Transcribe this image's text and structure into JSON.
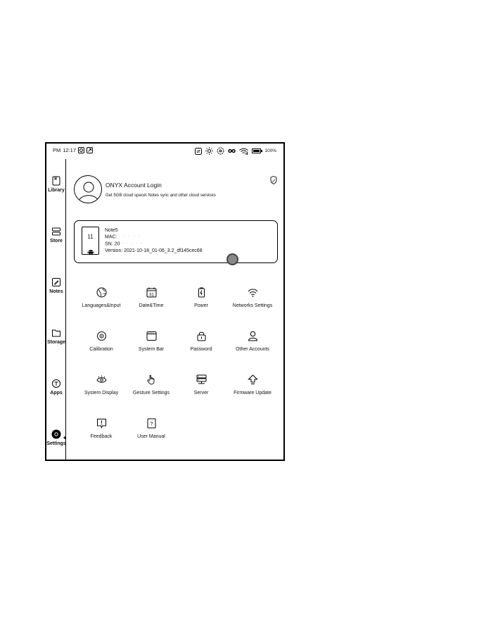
{
  "status_bar": {
    "time_period": "PM",
    "time": "12:17",
    "battery": "100%"
  },
  "sidebar": {
    "items": [
      {
        "label": "Library",
        "icon": "book-icon"
      },
      {
        "label": "Store",
        "icon": "store-icon"
      },
      {
        "label": "Notes",
        "icon": "pen-icon"
      },
      {
        "label": "Storage",
        "icon": "folder-icon"
      },
      {
        "label": "Apps",
        "icon": "apps-icon"
      },
      {
        "label": "Settings",
        "icon": "settings-icon",
        "active": true
      }
    ]
  },
  "account": {
    "title": "ONYX Account Login",
    "subtitle": "Get 5GB cloud space\\ Notes sync and other cloud services"
  },
  "device": {
    "icon_number": "11",
    "model": "Note5",
    "mac_label": "MAC:",
    "mac_value": "·  ·  ·  ·  ·",
    "sn_label": "SN: 20",
    "sn_value": "·  ·  ·  ·  ·",
    "version_label": "Version:",
    "version_value": "2021-10-18_01-06_3.2_df145cec68"
  },
  "settings_grid": [
    {
      "label": "Languages&Input",
      "icon": "language-icon"
    },
    {
      "label": "Date&Time",
      "icon": "calendar-icon",
      "icon_text": "31"
    },
    {
      "label": "Power",
      "icon": "power-icon"
    },
    {
      "label": "Networks Settings",
      "icon": "wifi-icon"
    },
    {
      "label": "Calibration",
      "icon": "calibration-icon"
    },
    {
      "label": "System Bar",
      "icon": "system-bar-icon"
    },
    {
      "label": "Password",
      "icon": "lock-icon"
    },
    {
      "label": "Other Accounts",
      "icon": "user-icon"
    },
    {
      "label": "System Display",
      "icon": "eye-icon"
    },
    {
      "label": "Gesture Settings",
      "icon": "hand-icon"
    },
    {
      "label": "Server",
      "icon": "server-icon"
    },
    {
      "label": "Firmware Update",
      "icon": "upgrade-icon"
    },
    {
      "label": "Feedback",
      "icon": "feedback-icon"
    },
    {
      "label": "User Manual",
      "icon": "manual-icon",
      "icon_text": "?"
    }
  ]
}
